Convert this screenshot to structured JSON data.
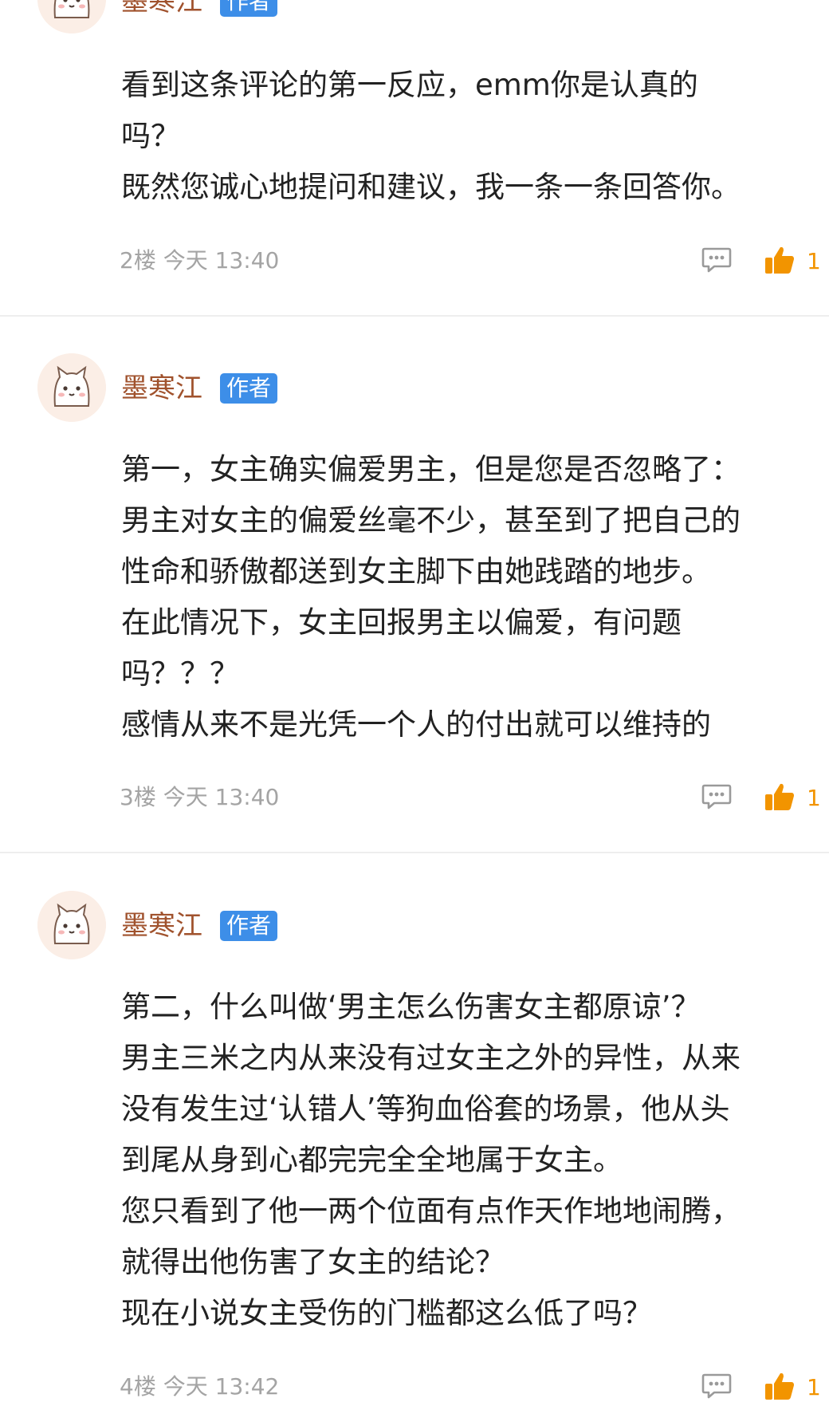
{
  "comments": [
    {
      "author": "墨寒江",
      "badge": "作者",
      "lines": [
        "看到这条评论的第一反应，emm你是认真的",
        "吗？",
        "既然您诚心地提问和建议，我一条一条回答你。"
      ],
      "floor": "2楼",
      "time": "今天 13:40",
      "likes": "1"
    },
    {
      "author": "墨寒江",
      "badge": "作者",
      "lines": [
        "第一，女主确实偏爱男主，但是您是否忽略了：",
        "男主对女主的偏爱丝毫不少，甚至到了把自己的",
        "性命和骄傲都送到女主脚下由她践踏的地步。",
        "在此情况下，女主回报男主以偏爱，有问题",
        "吗？？？",
        "感情从来不是光凭一个人的付出就可以维持的"
      ],
      "floor": "3楼",
      "time": "今天 13:40",
      "likes": "1"
    },
    {
      "author": "墨寒江",
      "badge": "作者",
      "lines": [
        "第二，什么叫做‘男主怎么伤害女主都原谅’？",
        "男主三米之内从来没有过女主之外的异性，从来",
        "没有发生过‘认错人’等狗血俗套的场景，他从头",
        "到尾从身到心都完完全全地属于女主。",
        "您只看到了他一两个位面有点作天作地地闹腾，",
        "就得出他伤害了女主的结论？",
        "现在小说女主受伤的门槛都这么低了吗？"
      ],
      "floor": "4楼",
      "time": "今天 13:42",
      "likes": "1"
    }
  ],
  "icons": {
    "avatar": "cat-avatar-icon",
    "reply": "comment-reply-icon",
    "like": "thumbs-up-icon"
  },
  "colors": {
    "author": "#a0522d",
    "badge_bg": "#3d8ee8",
    "text": "#222222",
    "meta": "#a4a4a4",
    "like": "#f29400",
    "reply_icon": "#9a9a9a",
    "divider": "#eeeeee"
  }
}
